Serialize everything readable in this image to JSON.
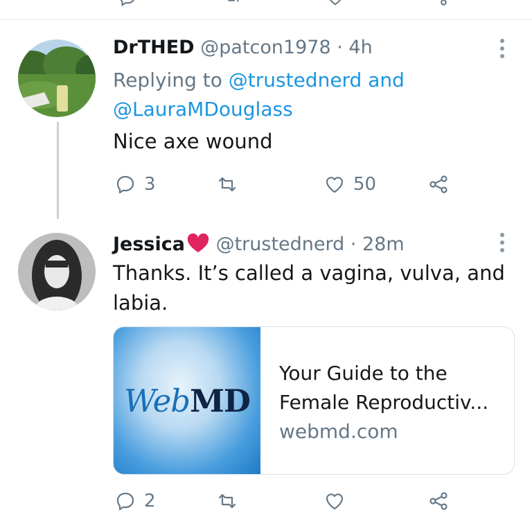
{
  "tweets": [
    {
      "display_name": "DrTHED",
      "handle": "@patcon1978",
      "time": "· 4h",
      "replying_prefix": "Replying to",
      "replying_user1": "@trustednerd",
      "replying_and": "and",
      "replying_user2": "@LauraMDouglass",
      "text": "Nice axe wound",
      "reply_count": "3",
      "retweet_count": "",
      "like_count": "50"
    },
    {
      "display_name": "Jessica",
      "handle": "@trustednerd",
      "time": "· 28m",
      "text_line1": "Thanks. It’s called a vagina, vulva, and",
      "text_line2": "labia.",
      "reply_count": "2",
      "retweet_count": "",
      "like_count": ""
    }
  ],
  "link_card": {
    "logo_web": "Web",
    "logo_md": "MD",
    "title_line1": "Your Guide to the",
    "title_line2": "Female Reproductiv...",
    "domain": "webmd.com"
  },
  "icons": {
    "reply": "reply-icon",
    "retweet": "retweet-icon",
    "like": "heart-icon",
    "share": "share-icon",
    "more": "more-vertical-icon",
    "heart_emoji": "red-heart-emoji"
  },
  "colors": {
    "link": "#1b95e0",
    "muted": "#657786",
    "heart": "#e0245e"
  }
}
